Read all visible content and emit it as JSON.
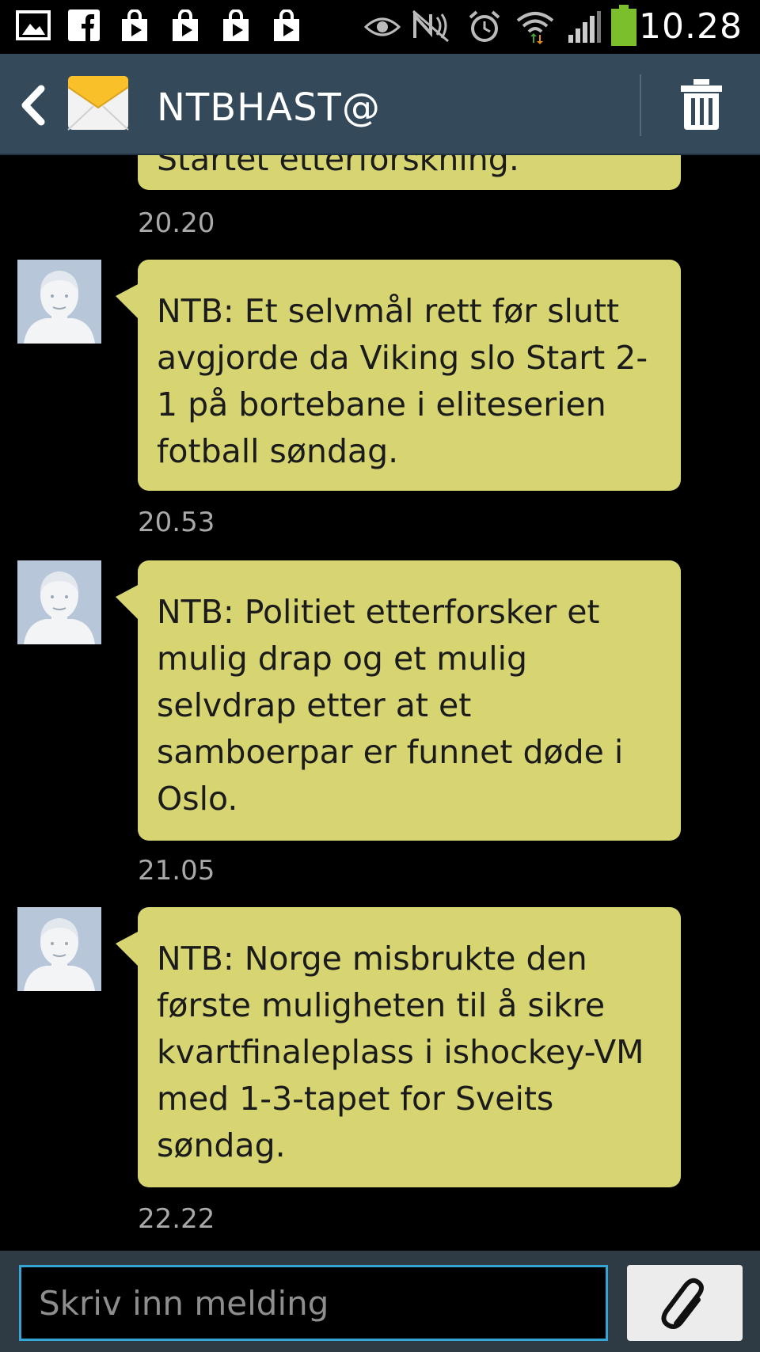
{
  "status_bar": {
    "time": "10.28",
    "icons": [
      "gallery-icon",
      "facebook-icon",
      "play-store-icon",
      "play-store-icon",
      "play-store-icon",
      "play-store-icon",
      "eye-icon",
      "nfc-icon",
      "alarm-icon",
      "wifi-icon",
      "signal-icon",
      "battery-icon"
    ]
  },
  "header": {
    "title": "NTBHAST@",
    "back_icon": "chevron-left-icon",
    "contact_icon": "envelope-icon",
    "delete_icon": "trash-icon"
  },
  "conversation": {
    "partial_message": "Startet etterforskning.",
    "messages": [
      {
        "text": "NTB: Et selvmål rett før slutt avgjorde da Viking slo Start 2-1 på bortebane i eliteserien fotball søndag.",
        "time": "20.53"
      },
      {
        "text": "NTB: Politiet etterforsker et mulig drap og et mulig selvdrap etter at et samboerpar er funnet døde i Oslo.",
        "time": "21.05"
      },
      {
        "text": "NTB: Norge misbrukte den første muligheten til å sikre kvartfinaleplass i ishockey-VM med 1-3-tapet for Sveits søndag.",
        "time": "22.22"
      }
    ],
    "first_time": "20.20"
  },
  "compose": {
    "placeholder": "Skriv inn melding",
    "attach_icon": "paperclip-icon"
  },
  "colors": {
    "header_bg": "#34495a",
    "bubble_bg": "#d6d572",
    "input_border": "#34a6d6"
  }
}
